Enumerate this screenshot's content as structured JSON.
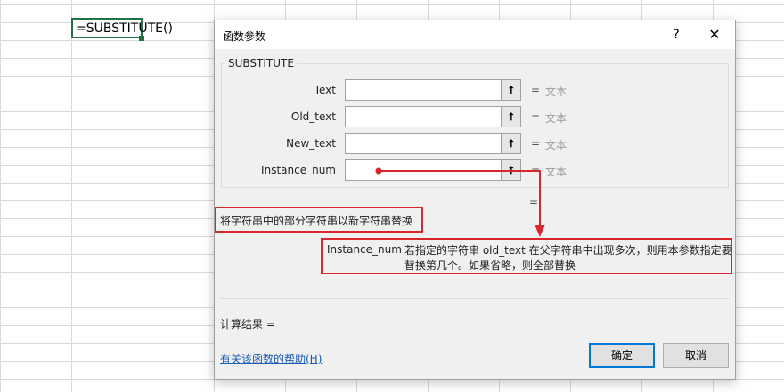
{
  "sheet": {
    "active_cell_formula": "=SUBSTITUTE()"
  },
  "dialog": {
    "title": "函数参数",
    "help_label": "?",
    "close_label": "✕",
    "function_name": "SUBSTITUTE",
    "args": [
      {
        "label": "Text",
        "value": "",
        "equals": "=",
        "result": "文本"
      },
      {
        "label": "Old_text",
        "value": "",
        "equals": "=",
        "result": "文本"
      },
      {
        "label": "New_text",
        "value": "",
        "equals": "=",
        "result": "文本"
      },
      {
        "label": "Instance_num",
        "value": "",
        "equals": "=",
        "result": "文本"
      }
    ],
    "ref_button_glyph": "⭡",
    "result_equals": "=",
    "description": "将字符串中的部分字符串以新字符串替换",
    "param_name": "Instance_num",
    "param_description": "若指定的字符串 old_text 在父字符串中出现多次，则用本参数指定要替换第几个。如果省略，则全部替换",
    "calc_result_label": "计算结果 =",
    "help_link": "有关该函数的帮助(H)",
    "ok_label": "确定",
    "cancel_label": "取消"
  },
  "colors": {
    "annotation_red": "#d9262c",
    "excel_green": "#217346",
    "focus_blue": "#0078d7",
    "link_blue": "#1a5bb5"
  }
}
